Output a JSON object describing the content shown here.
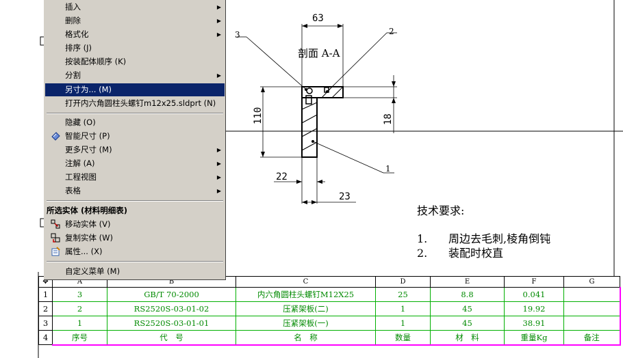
{
  "menu": {
    "items": [
      {
        "label": "插入",
        "submenu": true
      },
      {
        "label": "删除",
        "submenu": true
      },
      {
        "label": "格式化",
        "submenu": true
      },
      {
        "label": "排序 (J)",
        "submenu": false
      },
      {
        "label": "按装配体顺序 (K)",
        "submenu": false
      },
      {
        "label": "分割",
        "submenu": true
      },
      {
        "label": "另寸为... (M)",
        "submenu": false,
        "highlighted": true
      },
      {
        "label": "打开内六角圆柱头螺钉m12x25.sldprt (N)",
        "submenu": false
      }
    ],
    "items2": [
      {
        "label": "隐藏 (O)",
        "submenu": false
      },
      {
        "label": "智能尺寸 (P)",
        "submenu": false,
        "icon": "smart-dimension-icon"
      },
      {
        "label": "更多尺寸 (M)",
        "submenu": true
      },
      {
        "label": "注解 (A)",
        "submenu": true
      },
      {
        "label": "工程视图",
        "submenu": true
      },
      {
        "label": "表格",
        "submenu": true
      }
    ],
    "section_header": "所选实体 (材料明细表)",
    "items3": [
      {
        "label": "移动实体 (V)",
        "icon": "move-entity-icon"
      },
      {
        "label": "复制实体 (W)",
        "icon": "copy-entity-icon"
      },
      {
        "label": "属性... (X)",
        "icon": "properties-icon"
      }
    ],
    "custom": "自定义菜单 (M)",
    "arrow_glyph": "▶"
  },
  "drawing": {
    "section_title": "剖面 A-A",
    "dims": {
      "d63": "63",
      "d110": "110",
      "d18": "18",
      "d22": "22",
      "d23": "23"
    },
    "balloons": {
      "b1": "1",
      "b2": "2",
      "b3": "3"
    },
    "tech_title": "技术要求:",
    "tech_items": [
      {
        "num": "1.",
        "text": "周边去毛刺,棱角倒钝"
      },
      {
        "num": "2.",
        "text": "装配时校直"
      }
    ]
  },
  "bom": {
    "columns": [
      "A",
      "B",
      "C",
      "D",
      "E",
      "F",
      "G"
    ],
    "rows": [
      {
        "no": "1",
        "cells": [
          "3",
          "GB/T 70-2000",
          "内六角圆柱头螺钉M12X25",
          "25",
          "8.8",
          "0.041",
          ""
        ]
      },
      {
        "no": "2",
        "cells": [
          "2",
          "RS2520S-03-01-02",
          "压紧架板(二)",
          "1",
          "45",
          "19.92",
          ""
        ]
      },
      {
        "no": "3",
        "cells": [
          "1",
          "RS2520S-03-01-01",
          "压紧架板(一)",
          "1",
          "45",
          "38.91",
          ""
        ]
      },
      {
        "no": "4",
        "cells": [
          "序号",
          "代　号",
          "名　称",
          "数量",
          "材　料",
          "重量Kg",
          "备注"
        ]
      }
    ]
  }
}
